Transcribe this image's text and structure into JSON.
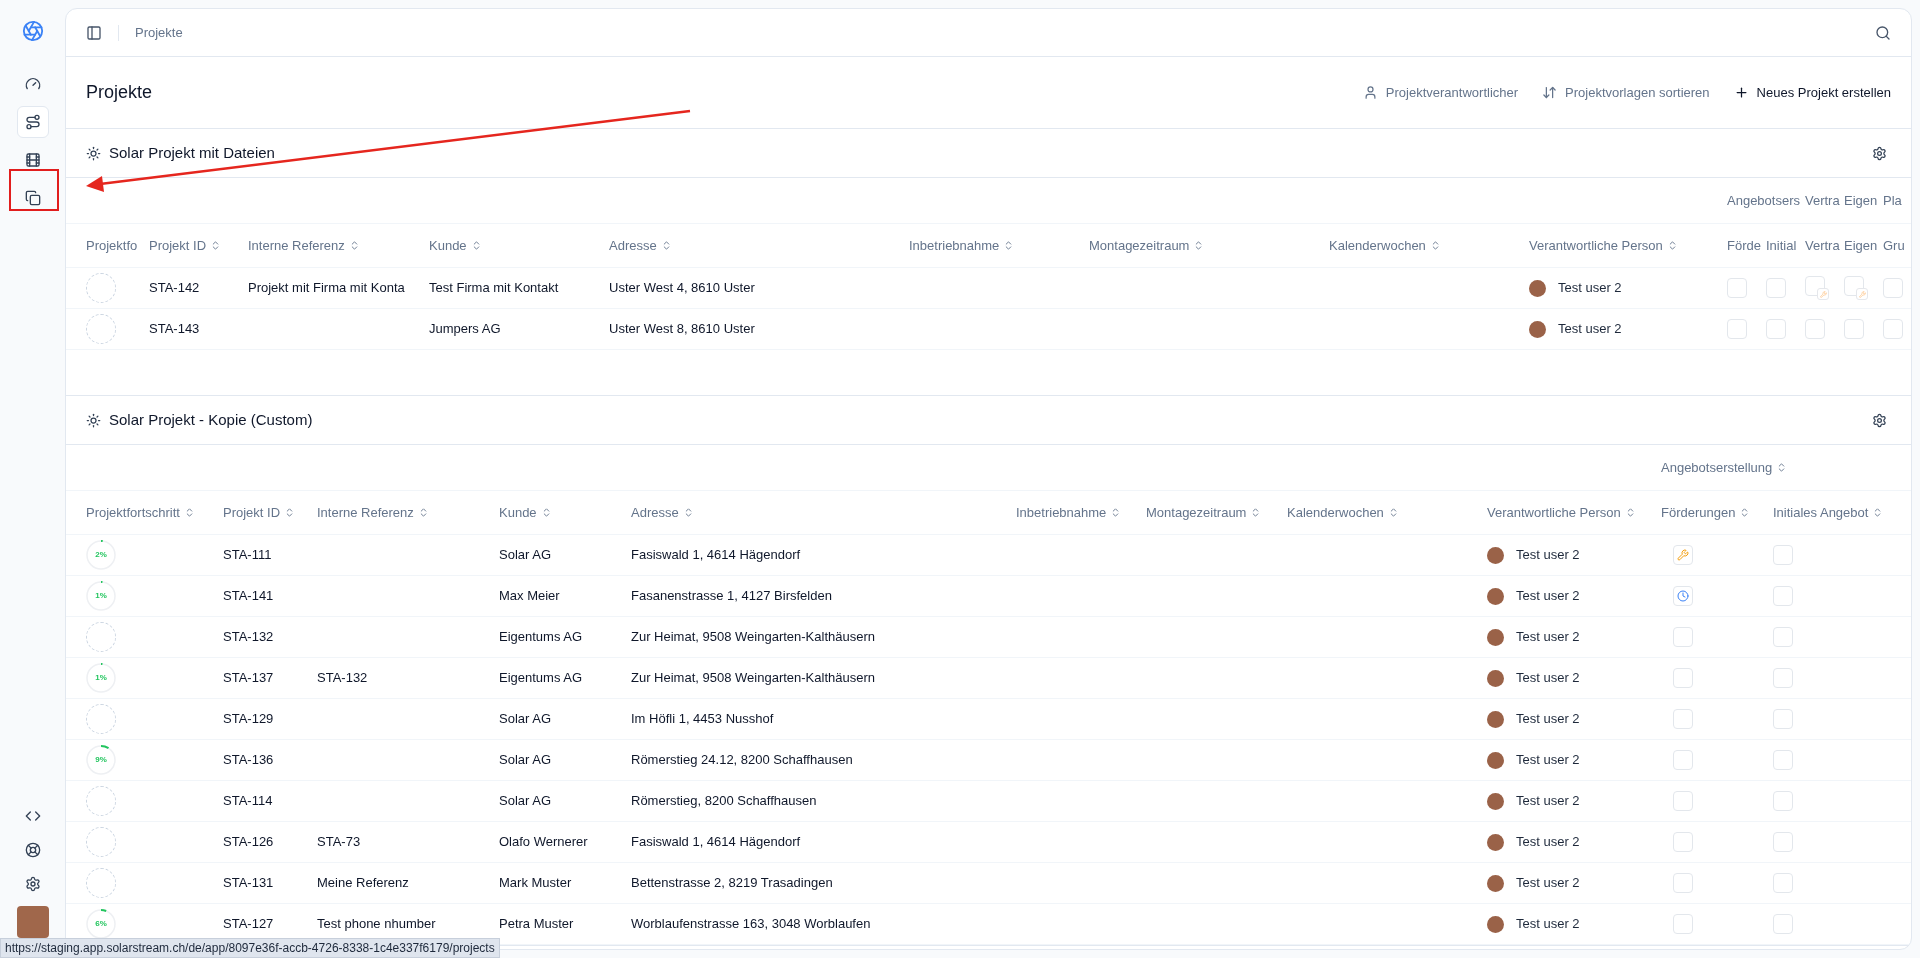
{
  "sidebar": {
    "nav": [
      {
        "selected": false
      },
      {
        "selected": true
      },
      {
        "selected": false
      },
      {
        "selected": false
      }
    ]
  },
  "topbar": {
    "breadcrumb": "Projekte"
  },
  "page": {
    "title": "Projekte",
    "actions": [
      {
        "label": "Projektverantwortlicher",
        "primary": false
      },
      {
        "label": "Projektvorlagen sortieren",
        "primary": false
      },
      {
        "label": "Neues Projekt erstellen",
        "primary": true
      }
    ]
  },
  "sections": [
    {
      "title": "Solar Projekt mit Dateien",
      "group_headers": [
        {
          "label": "Angebotsers"
        },
        {
          "label": "Vertra"
        },
        {
          "label": "Eigen"
        },
        {
          "label": "Pla"
        }
      ],
      "columns": [
        {
          "label": "Projektfo"
        },
        {
          "label": "Projekt ID",
          "sortable": true
        },
        {
          "label": "Interne Referenz",
          "sortable": true
        },
        {
          "label": "Kunde",
          "sortable": true
        },
        {
          "label": "Adresse",
          "sortable": true
        },
        {
          "label": "Inbetriebnahme",
          "sortable": true
        },
        {
          "label": "Montagezeitraum",
          "sortable": true
        },
        {
          "label": "Kalenderwochen",
          "sortable": true
        },
        {
          "label": "Verantwortliche Person",
          "sortable": true
        },
        {
          "label": "Förde"
        },
        {
          "label": "Initial"
        },
        {
          "label": "Vertra"
        },
        {
          "label": "Eigen"
        },
        {
          "label": "Gru"
        }
      ],
      "rows": [
        {
          "id": "STA-142",
          "ref": "Projekt mit Firma mit Konta",
          "customer": "Test Firma mit Kontakt",
          "address": "Uster West 4, 8610 Uster",
          "person": "Test user 2",
          "status": [
            {
              "kind": "empty",
              "checked": false
            },
            {
              "kind": "empty",
              "checked": false
            },
            {
              "kind": "badge",
              "checked": false
            },
            {
              "kind": "badge",
              "checked": false
            },
            {
              "kind": "empty",
              "checked": false
            }
          ]
        },
        {
          "id": "STA-143",
          "customer": "Jumpers AG",
          "address": "Uster West 8, 8610 Uster",
          "person": "Test user 2",
          "status": [
            {
              "kind": "empty",
              "checked": false
            },
            {
              "kind": "empty",
              "checked": false
            },
            {
              "kind": "empty",
              "checked": false
            },
            {
              "kind": "empty",
              "checked": false
            },
            {
              "kind": "empty",
              "checked": false
            }
          ]
        }
      ]
    },
    {
      "title": "Solar Projekt - Kopie (Custom)",
      "group_headers": [
        {
          "label": "Angebotserstellung",
          "sortable": true
        }
      ],
      "columns": [
        {
          "label": "Projektfortschritt",
          "sortable": true
        },
        {
          "label": "Projekt ID",
          "sortable": true
        },
        {
          "label": "Interne Referenz",
          "sortable": true
        },
        {
          "label": "Kunde",
          "sortable": true
        },
        {
          "label": "Adresse",
          "sortable": true
        },
        {
          "label": "Inbetriebnahme",
          "sortable": true
        },
        {
          "label": "Montagezeitraum",
          "sortable": true
        },
        {
          "label": "Kalenderwochen",
          "sortable": true
        },
        {
          "label": "Verantwortliche Person",
          "sortable": true
        },
        {
          "label": "Förderungen",
          "sortable": true
        },
        {
          "label": "Initiales Angebot",
          "sortable": true
        }
      ],
      "rows": [
        {
          "progress": {
            "level": 0.02,
            "label": "2%"
          },
          "id": "STA-111",
          "customer": "Solar AG",
          "address": "Fasiswald 1, 4614 Hägendorf",
          "person": "Test user 2",
          "status": [
            {
              "kind": "wrench"
            },
            {
              "kind": "empty",
              "checked": false
            }
          ]
        },
        {
          "progress": {
            "level": 0.01,
            "label": "1%"
          },
          "id": "STA-141",
          "customer": "Max Meier",
          "address": "Fasanenstrasse 1, 4127 Birsfelden",
          "person": "Test user 2",
          "status": [
            {
              "kind": "clock"
            },
            {
              "kind": "empty",
              "checked": false
            }
          ]
        },
        {
          "id": "STA-132",
          "customer": "Eigentums AG",
          "address": "Zur Heimat, 9508 Weingarten-Kalthäusern",
          "person": "Test user 2",
          "status": [
            {
              "kind": "empty",
              "checked": false
            },
            {
              "kind": "empty",
              "checked": false
            }
          ]
        },
        {
          "progress": {
            "level": 0.01,
            "label": "1%"
          },
          "id": "STA-137",
          "ref": "STA-132",
          "customer": "Eigentums AG",
          "address": "Zur Heimat, 9508 Weingarten-Kalthäusern",
          "person": "Test user 2",
          "status": [
            {
              "kind": "empty",
              "checked": false
            },
            {
              "kind": "empty",
              "checked": false
            }
          ]
        },
        {
          "id": "STA-129",
          "customer": "Solar AG",
          "address": "Im Höfli 1, 4453 Nusshof",
          "person": "Test user 2",
          "status": [
            {
              "kind": "empty",
              "checked": false
            },
            {
              "kind": "empty",
              "checked": false
            }
          ]
        },
        {
          "progress": {
            "level": 0.09,
            "label": "9%"
          },
          "id": "STA-136",
          "customer": "Solar AG",
          "address": "Römerstieg 24.12, 8200 Schaffhausen",
          "person": "Test user 2",
          "status": [
            {
              "kind": "empty",
              "checked": false
            },
            {
              "kind": "empty",
              "checked": false
            }
          ]
        },
        {
          "id": "STA-114",
          "customer": "Solar AG",
          "address": "Römerstieg, 8200 Schaffhausen",
          "person": "Test user 2",
          "status": [
            {
              "kind": "empty",
              "checked": false
            },
            {
              "kind": "empty",
              "checked": false
            }
          ]
        },
        {
          "id": "STA-126",
          "ref": "STA-73",
          "customer": "Olafo Wernerer",
          "address": "Fasiswald 1, 4614 Hägendorf",
          "person": "Test user 2",
          "status": [
            {
              "kind": "empty",
              "checked": false
            },
            {
              "kind": "empty",
              "checked": false
            }
          ]
        },
        {
          "id": "STA-131",
          "ref": "Meine Referenz",
          "customer": "Mark Muster",
          "address": "Bettenstrasse 2, 8219 Trasadingen",
          "person": "Test user 2",
          "status": [
            {
              "kind": "empty",
              "checked": false
            },
            {
              "kind": "empty",
              "checked": false
            }
          ]
        },
        {
          "progress": {
            "level": 0.06,
            "label": "6%"
          },
          "id": "STA-127",
          "ref": "Test phone nhumber",
          "customer": "Petra Muster",
          "address": "Worblaufenstrasse 163, 3048 Worblaufen",
          "person": "Test user 2",
          "status": [
            {
              "kind": "empty",
              "checked": false
            },
            {
              "kind": "empty",
              "checked": false
            }
          ]
        }
      ]
    }
  ],
  "status_url": "https://staging.app.solarstream.ch/de/app/8097e36f-accb-4726-8338-1c4e337f6179/projects"
}
